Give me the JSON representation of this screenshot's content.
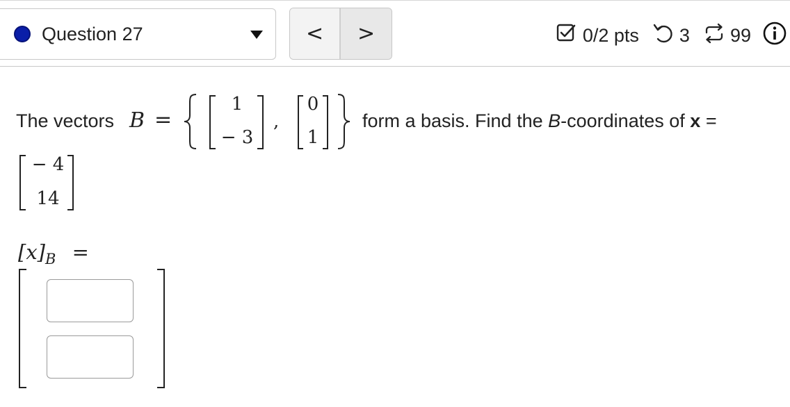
{
  "header": {
    "question_label": "Question 27",
    "status_color": "#0a1ea8",
    "prev_label": "<",
    "next_label": ">",
    "score": "0/2 pts",
    "attempts": "3",
    "submissions": "99",
    "icons": {
      "status": "filled-circle-icon",
      "dropdown": "caret-down-icon",
      "score": "checkbox-icon",
      "attempts": "undo-arrow-icon",
      "submissions": "retry-cycle-icon",
      "info": "info-icon"
    }
  },
  "question": {
    "intro": "The vectors",
    "symbol_B": "B",
    "equals": "=",
    "basis_vector_1": [
      "1",
      "− 3"
    ],
    "basis_vector_2": [
      "0",
      "1"
    ],
    "separator": ",",
    "text_after": "form a basis. Find the",
    "B_italic": "B",
    "text_coordinates": "-coordinates of",
    "bold_x": "x",
    "equals2": "=",
    "x_vector": [
      "− 4",
      "14"
    ]
  },
  "answer": {
    "label_x": "[x]",
    "label_sub": "B",
    "label_equals": "=",
    "inputs": [
      {
        "value": "",
        "placeholder": ""
      },
      {
        "value": "",
        "placeholder": ""
      }
    ]
  }
}
